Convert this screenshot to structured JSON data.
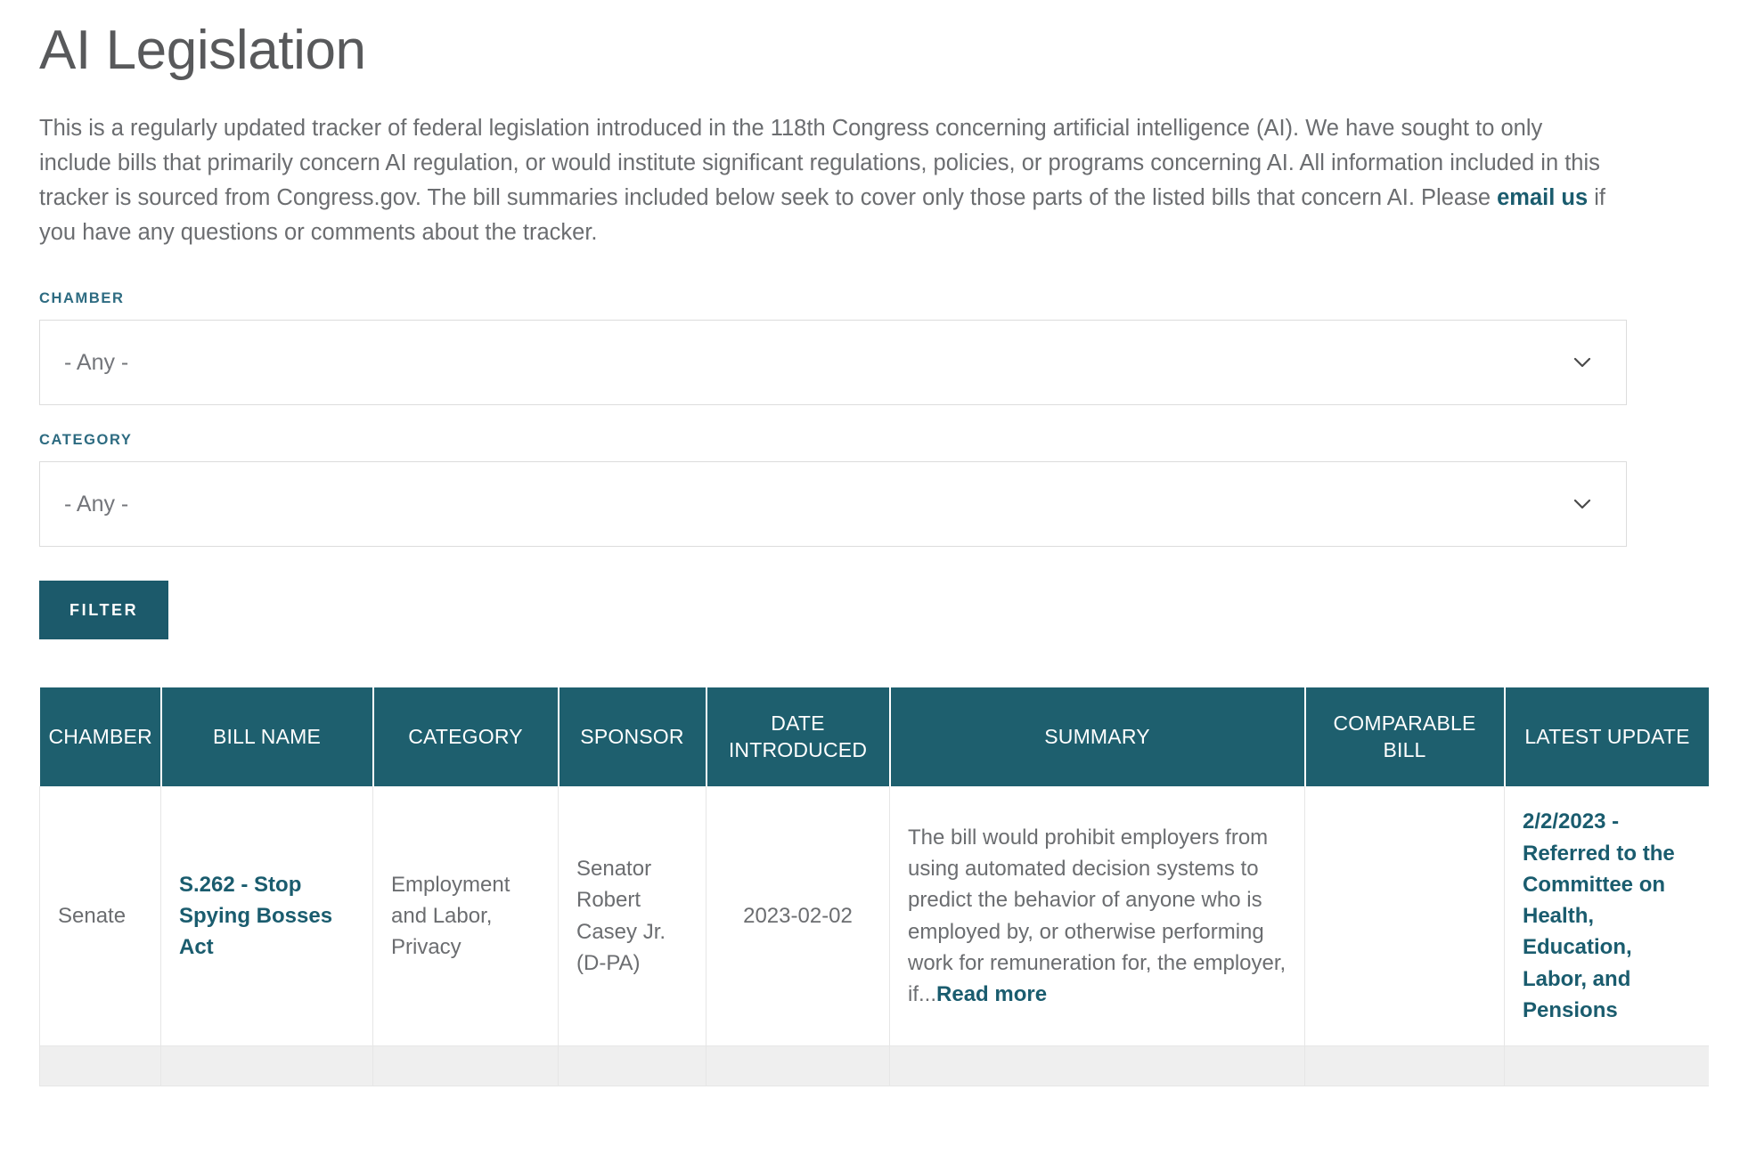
{
  "page": {
    "title": "AI Legislation",
    "intro_before_link": "This is a regularly updated tracker of federal legislation introduced in the 118th Congress concerning artificial intelligence (AI). We have sought to only include bills that primarily concern AI regulation, or would institute significant regulations, policies, or programs concerning AI. All information included in this tracker is sourced from Congress.gov. The bill summaries included below seek to cover only those parts of the listed bills that concern AI. Please ",
    "intro_link": "email us",
    "intro_after_link": " if you have any questions or comments about the tracker."
  },
  "filters": {
    "chamber": {
      "label": "CHAMBER",
      "value": "- Any -",
      "icon": "chevron-down-icon"
    },
    "category": {
      "label": "CATEGORY",
      "value": "- Any -",
      "icon": "chevron-down-icon"
    },
    "submit_label": "FILTER"
  },
  "table": {
    "headers": [
      "CHAMBER",
      "BILL NAME",
      "CATEGORY",
      "SPONSOR",
      "DATE INTRODUCED",
      "SUMMARY",
      "COMPARABLE BILL",
      "LATEST UPDATE"
    ],
    "rows": [
      {
        "chamber": "Senate",
        "bill_name": "S.262 - Stop Spying Bosses Act",
        "category": "Employment and Labor, Privacy",
        "sponsor": "Senator Robert Casey Jr. (D-PA)",
        "date_introduced": "2023-02-02",
        "summary_text": "The bill would prohibit employers from using automated decision systems to predict the behavior of anyone who is employed by, or otherwise performing work for remuneration for, the employer, if...",
        "summary_link": "Read more",
        "comparable_bill": "",
        "latest_update": "2/2/2023 - Referred to the Committee on Health, Education, Labor, and Pensions"
      }
    ]
  },
  "colors": {
    "brand_teal": "#1e5f6e",
    "link_teal": "#1a5c6e",
    "label_teal": "#2d6b81",
    "button_teal": "#1c5a6b",
    "body_text": "#6b6d70",
    "title_text": "#58595b"
  }
}
